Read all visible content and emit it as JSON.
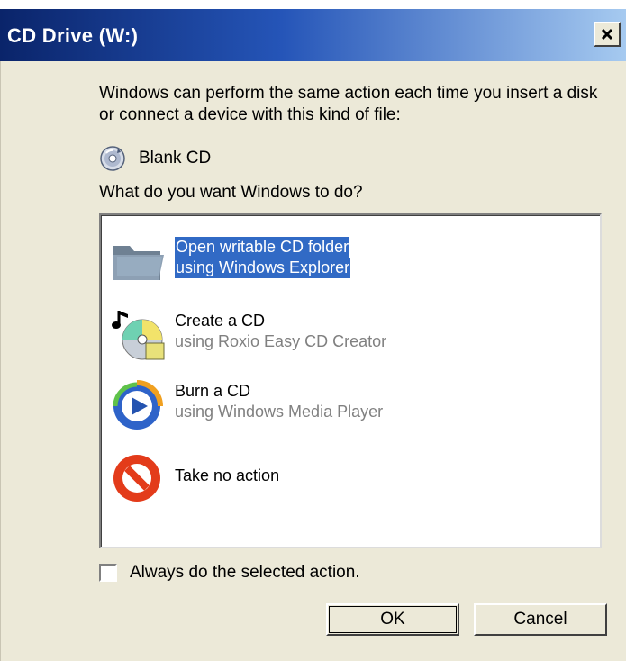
{
  "window": {
    "title": "CD Drive (W:)",
    "close_label": "Close"
  },
  "description": "Windows can perform the same action each time you insert a disk or connect a device with this kind of file:",
  "content_type": {
    "label": "Blank CD",
    "icon": "cd-icon"
  },
  "question": "What do you want Windows to do?",
  "actions": [
    {
      "main": "Open writable CD folder",
      "sub": "using Windows Explorer",
      "icon": "folder-icon",
      "selected": true
    },
    {
      "main": "Create a CD",
      "sub": "using Roxio Easy CD Creator",
      "icon": "roxio-icon",
      "selected": false
    },
    {
      "main": "Burn a CD",
      "sub": "using Windows Media Player",
      "icon": "media-player-icon",
      "selected": false
    },
    {
      "main": "Take no action",
      "sub": "",
      "icon": "no-action-icon",
      "selected": false
    }
  ],
  "always_checkbox": {
    "label": "Always do the selected action.",
    "checked": false
  },
  "buttons": {
    "ok": "OK",
    "cancel": "Cancel"
  },
  "colors": {
    "title_start": "#0a246a",
    "title_end": "#a6caf0",
    "selection": "#316ac5",
    "dialog_bg": "#ece9d8"
  }
}
